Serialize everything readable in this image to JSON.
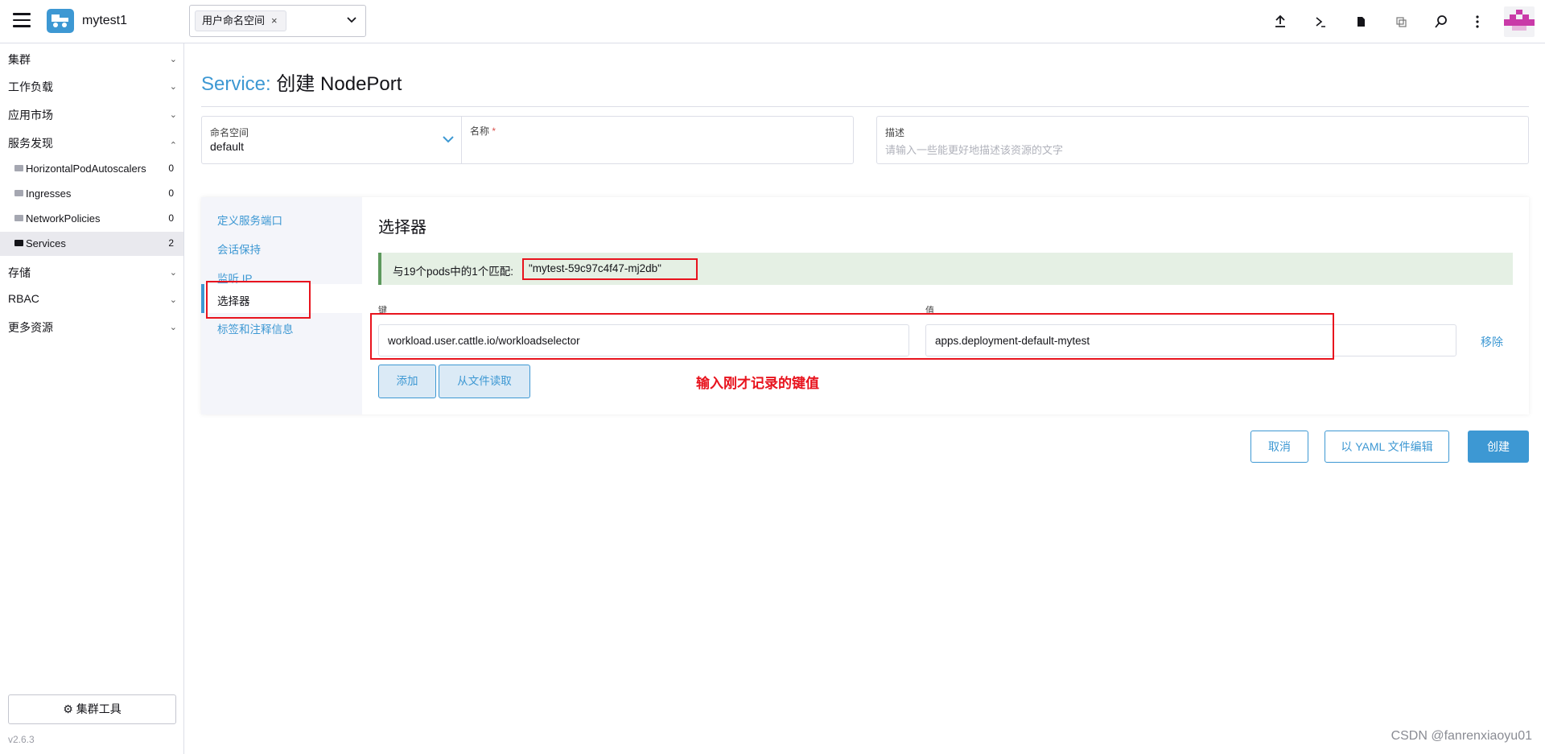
{
  "header": {
    "cluster_name": "mytest1",
    "namespace_chip": "用户命名空间",
    "chip_remove": "×",
    "icons": [
      "upload-icon",
      "terminal-icon",
      "file-icon",
      "copy-icon",
      "search-icon",
      "more-vert-icon"
    ]
  },
  "sidebar": {
    "groups": [
      {
        "label": "集群"
      },
      {
        "label": "工作负载"
      },
      {
        "label": "应用市场"
      },
      {
        "label": "服务发现"
      },
      {
        "label": "存储"
      },
      {
        "label": "RBAC"
      },
      {
        "label": "更多资源"
      }
    ],
    "items": [
      {
        "label": "HorizontalPodAutoscalers",
        "count": "0"
      },
      {
        "label": "Ingresses",
        "count": "0"
      },
      {
        "label": "NetworkPolicies",
        "count": "0"
      },
      {
        "label": "Services",
        "count": "2"
      }
    ],
    "tools_label": "集群工具",
    "version": "v2.6.3"
  },
  "page": {
    "title_prefix": "Service:",
    "title_main": "创建 NodePort"
  },
  "form": {
    "namespace_label": "命名空间",
    "namespace_value": "default",
    "name_label": "名称",
    "name_required": "*",
    "desc_label": "描述",
    "desc_placeholder": "请输入一些能更好地描述该资源的文字"
  },
  "tabs": [
    "定义服务端口",
    "会话保持",
    "监听 IP",
    "选择器",
    "标签和注释信息"
  ],
  "selector": {
    "title": "选择器",
    "match_text": "与19个pods中的1个匹配:",
    "match_pod": "\"mytest-59c97c4f47-mj2db\"",
    "key_label": "键",
    "value_label": "值",
    "key_value": "workload.user.cattle.io/workloadselector",
    "value_value": "apps.deployment-default-mytest",
    "remove_label": "移除",
    "add_label": "添加",
    "read_file_label": "从文件读取"
  },
  "annotation": "输入刚才记录的键值",
  "footer": {
    "cancel_label": "取消",
    "yaml_label": "以 YAML 文件编辑",
    "create_label": "创建"
  },
  "watermark": "CSDN @fanrenxiaoyu01"
}
